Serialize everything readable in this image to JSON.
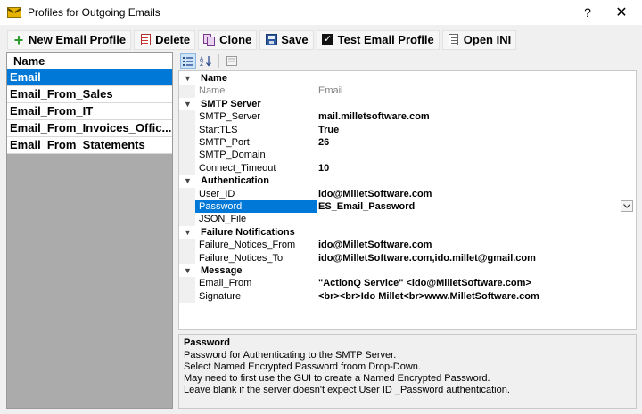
{
  "window": {
    "title": "Profiles for Outgoing Emails",
    "help": "?",
    "close": "✕"
  },
  "toolbar": {
    "new_label": "New Email Profile",
    "delete_label": "Delete",
    "clone_label": "Clone",
    "save_label": "Save",
    "test_label": "Test Email Profile",
    "openini_label": "Open INI"
  },
  "list": {
    "header": "Name",
    "items": [
      "Email",
      "Email_From_Sales",
      "Email_From_IT",
      "Email_From_Invoices_Offic...",
      "Email_From_Statements"
    ],
    "selected_index": 0
  },
  "grid": {
    "categories": {
      "name": "Name",
      "smtp": "SMTP Server",
      "auth": "Authentication",
      "failure": "Failure Notifications",
      "message": "Message"
    },
    "props": {
      "name": {
        "label": "Name",
        "value": "Email"
      },
      "smtp_server": {
        "label": "SMTP_Server",
        "value": "mail.milletsoftware.com"
      },
      "starttls": {
        "label": "StartTLS",
        "value": "True"
      },
      "smtp_port": {
        "label": "SMTP_Port",
        "value": "26"
      },
      "smtp_domain": {
        "label": "SMTP_Domain",
        "value": ""
      },
      "connect_timeout": {
        "label": "Connect_Timeout",
        "value": "10"
      },
      "user_id": {
        "label": "User_ID",
        "value": "ido@MilletSoftware.com"
      },
      "password": {
        "label": "Password",
        "value": "ES_Email_Password"
      },
      "json_file": {
        "label": "JSON_File",
        "value": ""
      },
      "failure_from": {
        "label": "Failure_Notices_From",
        "value": "ido@MilletSoftware.com"
      },
      "failure_to": {
        "label": "Failure_Notices_To",
        "value": "ido@MilletSoftware.com,ido.millet@gmail.com"
      },
      "email_from": {
        "label": "Email_From",
        "value": "\"ActionQ Service\" <ido@MilletSoftware.com>"
      },
      "signature": {
        "label": "Signature",
        "value": "<br><br>Ido Millet<br>www.MilletSoftware.com"
      }
    }
  },
  "description": {
    "title": "Password",
    "lines": [
      "Password for Authenticating to the SMTP Server.",
      "Select Named Encrypted Password froom Drop-Down.",
      "May need to first use the GUI to create a Named Encrypted Password.",
      "Leave blank if the server doesn't expect User ID _Password authentication."
    ]
  }
}
